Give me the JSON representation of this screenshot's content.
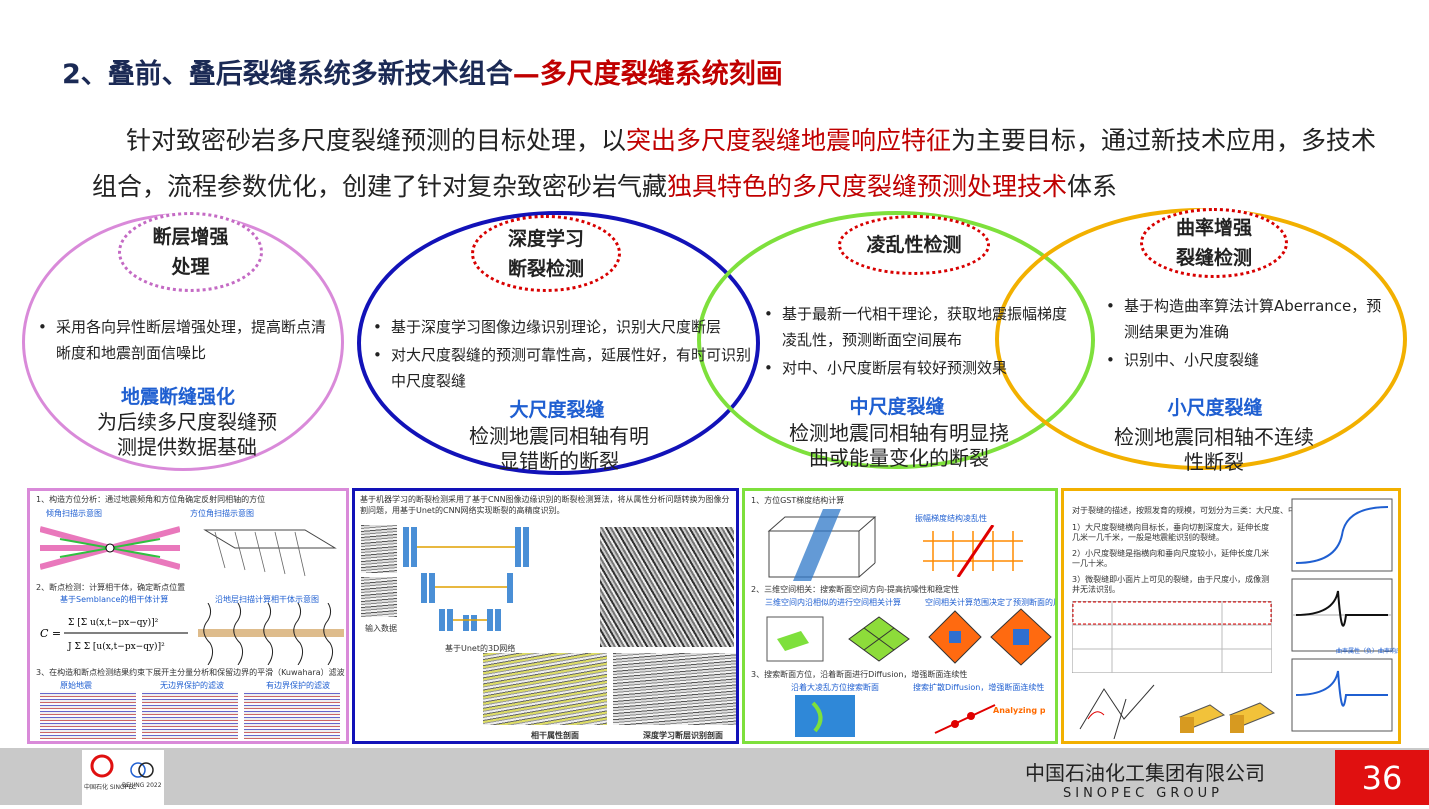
{
  "title": {
    "prefix": "2、叠前、叠后裂缝系统多新技术组合",
    "highlight": "—多尺度裂缝系统刻画"
  },
  "intro": {
    "p1": "针对致密砂岩多尺度裂缝预测的目标处理，以",
    "p1_red": "突出多尺度裂缝地震响应特征",
    "p2": "为主要目标，通过新技术应用，多技术组合，流程参数优化，创建了针对复杂致密砂岩气藏",
    "p2_red": "独具特色的多尺度裂缝预测处理技术",
    "p3": "体系"
  },
  "methods": [
    {
      "tag": "断层增强处理",
      "bullets": [
        "采用各向异性断层增强处理，提高断点清晰度和地震剖面信噪比"
      ],
      "scale": "地震断缝强化",
      "desc": "为后续多尺度裂缝预测提供数据基础",
      "color": "#d98ad9"
    },
    {
      "tag": "深度学习断裂检测",
      "bullets": [
        "基于深度学习图像边缘识别理论，识别大尺度断层",
        "对大尺度裂缝的预测可靠性高，延展性好，有时可识别中尺度裂缝"
      ],
      "scale": "大尺度裂缝",
      "desc": "检测地震同相轴有明显错断的断裂",
      "color": "#1212b8"
    },
    {
      "tag": "凌乱性检测",
      "bullets": [
        "基于最新一代相干理论，获取地震振幅梯度凌乱性，预测断面空间展布",
        "对中、小尺度断层有较好预测效果"
      ],
      "scale": "中尺度裂缝",
      "desc": "检测地震同相轴有明显挠曲或能量变化的断裂",
      "color": "#7ee03c"
    },
    {
      "tag": "曲率增强裂缝检测",
      "bullets": [
        "基于构造曲率算法计算Aberrance，预测结果更为准确",
        "识别中、小尺度裂缝"
      ],
      "scale": "小尺度裂缝",
      "desc": "检测地震同相轴不连续性断裂",
      "color": "#f2b000"
    }
  ],
  "panels": {
    "p1": {
      "lines": [
        "1、构造方位分析：通过地震频角和方位角确定反射同相轴的方位",
        "2、断点检测：计算相干体，确定断点位置",
        "3、在构造和断点检测结果约束下展开主分量分析和保留边界的平滑（Kuwahara）滤波"
      ],
      "labels": [
        "倾角扫描示意图",
        "方位角扫描示意图",
        "基于Semblance的相干体计算",
        "沿地层扫描计算相干体示意图",
        "原始地震",
        "无边界保护的滤波",
        "有边界保护的滤波"
      ]
    },
    "p2": {
      "lines": [
        "基于机器学习的断裂检测采用了基于CNN图像边缘识别的断裂检测算法，将从属性分析问题转换为图像分割问题，用基于Unet的CNN网络实现断裂的高精度识别。"
      ],
      "labels": [
        "输入数据",
        "基于Unet的3D网络",
        "相干属性剖面",
        "深度学习断层识别剖面"
      ]
    },
    "p3": {
      "lines": [
        "1、方位GST梯度结构计算",
        "2、三维空间相关：搜索断面空间方向-提高抗噪性和稳定性",
        "3、搜索断面方位，沿着断面进行Diffusion，增强断面连续性"
      ],
      "labels": [
        "振幅梯度结构凌乱性",
        "计算梯度凌乱程度最大值",
        "三维空间内沿相似的进行空间相关计算",
        "空间相关计算范围决定了预测断面的尺度",
        "沿着大凌乱方位搜索断面",
        "搜索扩散Diffusion，增强断面连续性",
        "Analyzing point"
      ]
    },
    "p4": {
      "lines": [
        "对于裂缝的描述，按照发育的规模，可划分为三类：大尺度、中尺度和微裂缝。",
        "1）大尺度裂缝横向目标长，垂向切割深度大，延伸长度几米一几千米，一般是地震能识别的裂缝。",
        "2）小尺度裂缝是指横向和垂向尺度较小，延伸长度几米一几十米。",
        "3）微裂缝即小面片上可见的裂缝，由于尺度小，成像测井无法识别。"
      ],
      "labels": [
        "曲率属性（负）曲率响应特征",
        "Analyzing point"
      ]
    }
  },
  "footer": {
    "company": "中国石油化工集团有限公司",
    "group": "SINOPEC GROUP",
    "page": "36",
    "logo1": "中国石化 SINOPEC",
    "logo2": "BEIJING 2022"
  }
}
